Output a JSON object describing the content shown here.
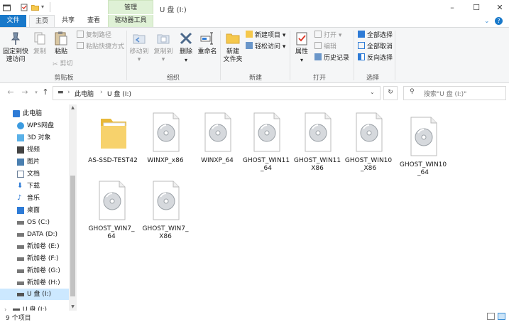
{
  "window": {
    "title": "U 盘 (I:)",
    "context_tab_header": "管理",
    "help_icon": "help-icon"
  },
  "ribbon_tabs": [
    {
      "label": "文件"
    },
    {
      "label": "主页"
    },
    {
      "label": "共享"
    },
    {
      "label": "查看"
    },
    {
      "label": "驱动器工具"
    }
  ],
  "ribbon": {
    "clipboard": {
      "pin_label": "固定到快\n速访问",
      "copy_label": "复制",
      "paste_label": "粘贴",
      "copy_path_label": "复制路径",
      "paste_shortcut_label": "粘贴快捷方式",
      "cut_label": "剪切",
      "group_label": "剪贴板"
    },
    "organize": {
      "move_to_label": "移动到",
      "copy_to_label": "复制到",
      "delete_label": "删除",
      "rename_label": "重命名",
      "group_label": "组织"
    },
    "new": {
      "new_folder_label": "新建\n文件夹",
      "new_item_label": "新建项目",
      "easy_access_label": "轻松访问",
      "group_label": "新建"
    },
    "open": {
      "properties_label": "属性",
      "open_label": "打开",
      "edit_label": "编辑",
      "history_label": "历史记录",
      "group_label": "打开"
    },
    "select": {
      "select_all_label": "全部选择",
      "select_none_label": "全部取消",
      "invert_label": "反向选择",
      "group_label": "选择"
    }
  },
  "address_bar": {
    "segments": [
      "此电脑",
      "U 盘 (I:)"
    ],
    "search_placeholder": "搜索\"U 盘 (I:)\""
  },
  "nav_pane": {
    "items": [
      {
        "label": "此电脑",
        "icon": "computer-icon",
        "selected": false
      },
      {
        "label": "WPS网盘",
        "icon": "cloud-icon",
        "selected": false
      },
      {
        "label": "3D 对象",
        "icon": "cube-icon",
        "selected": false
      },
      {
        "label": "视频",
        "icon": "video-icon",
        "selected": false
      },
      {
        "label": "图片",
        "icon": "picture-icon",
        "selected": false
      },
      {
        "label": "文档",
        "icon": "document-icon",
        "selected": false
      },
      {
        "label": "下载",
        "icon": "download-icon",
        "selected": false
      },
      {
        "label": "音乐",
        "icon": "music-icon",
        "selected": false
      },
      {
        "label": "桌面",
        "icon": "desktop-icon",
        "selected": false
      },
      {
        "label": "OS (C:)",
        "icon": "drive-icon",
        "selected": false
      },
      {
        "label": "DATA (D:)",
        "icon": "drive-icon",
        "selected": false
      },
      {
        "label": "新加卷 (E:)",
        "icon": "drive-icon",
        "selected": false
      },
      {
        "label": "新加卷 (F:)",
        "icon": "drive-icon",
        "selected": false
      },
      {
        "label": "新加卷 (G:)",
        "icon": "drive-icon",
        "selected": false
      },
      {
        "label": "新加卷 (H:)",
        "icon": "drive-icon",
        "selected": false
      },
      {
        "label": "U 盘 (I:)",
        "icon": "usb-drive-icon",
        "selected": true
      },
      {
        "label": "U 盘 (I:)",
        "icon": "usb-drive-icon",
        "selected": false
      }
    ]
  },
  "files": [
    {
      "name": "AS-SSD-TEST42",
      "type": "folder"
    },
    {
      "name": "WINXP_x86",
      "type": "disc-image"
    },
    {
      "name": "WINXP_64",
      "type": "disc-image"
    },
    {
      "name": "GHOST_WIN11_64",
      "type": "disc-image"
    },
    {
      "name": "GHOST_WIN11X86",
      "type": "disc-image"
    },
    {
      "name": "GHOST_WIN10_X86",
      "type": "disc-image"
    },
    {
      "name": "GHOST_WIN10_64",
      "type": "disc-image"
    },
    {
      "name": "GHOST_WIN7_64",
      "type": "disc-image"
    },
    {
      "name": "GHOST_WIN7_X86",
      "type": "disc-image"
    }
  ],
  "status_bar": {
    "item_count": "9 个项目"
  },
  "colors": {
    "accent": "#1979ca",
    "context_tab": "#dff1d6",
    "selection": "#cce8ff"
  }
}
